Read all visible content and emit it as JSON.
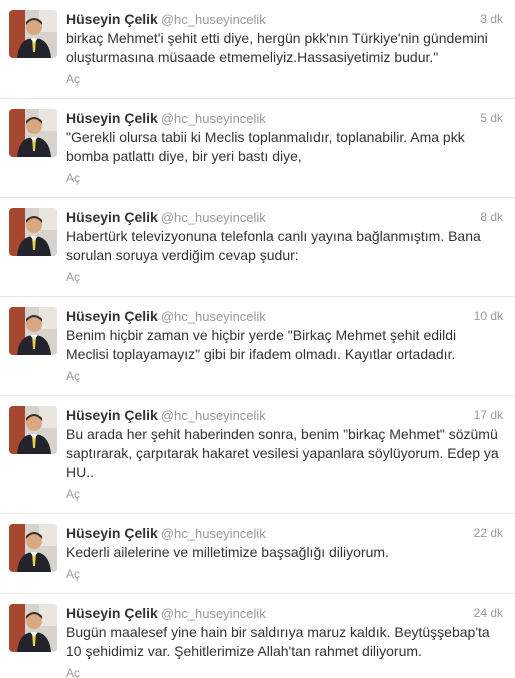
{
  "tweets": [
    {
      "fullname": "Hüseyin Çelik",
      "username": "@hc_huseyincelik",
      "time": "3 dk",
      "text": "birkaç Mehmet'i şehit etti diye, hergün pkk'nın Türkiye'nin gündemini oluşturmasına müsaade etmemeliyiz.Hassasiyetimiz budur.\"",
      "action": "Aç"
    },
    {
      "fullname": "Hüseyin Çelik",
      "username": "@hc_huseyincelik",
      "time": "5 dk",
      "text": "\"Gerekli olursa tabii ki Meclis toplanmalıdır, toplanabilir. Ama pkk bomba patlattı diye, bir yeri bastı diye,",
      "action": "Aç"
    },
    {
      "fullname": "Hüseyin Çelik",
      "username": "@hc_huseyincelik",
      "time": "8 dk",
      "text": "Habertürk televizyonuna telefonla canlı yayına bağlanmıştım. Bana sorulan soruya verdiğim cevap şudur:",
      "action": "Aç"
    },
    {
      "fullname": "Hüseyin Çelik",
      "username": "@hc_huseyincelik",
      "time": "10 dk",
      "text": "Benim hiçbir zaman ve hiçbir yerde \"Birkaç Mehmet şehit edildi Meclisi toplayamayız\" gibi bir ifadem olmadı. Kayıtlar ortadadır.",
      "action": "Aç"
    },
    {
      "fullname": "Hüseyin Çelik",
      "username": "@hc_huseyincelik",
      "time": "17 dk",
      "text": "Bu arada her şehit haberinden sonra, benim \"birkaç Mehmet\" sözümü saptırarak, çarpıtarak hakaret vesilesi yapanlara söylüyorum. Edep ya HU..",
      "action": "Aç"
    },
    {
      "fullname": "Hüseyin Çelik",
      "username": "@hc_huseyincelik",
      "time": "22 dk",
      "text": "Kederli ailelerine ve milletimize başsağlığı diliyorum.",
      "action": "Aç"
    },
    {
      "fullname": "Hüseyin Çelik",
      "username": "@hc_huseyincelik",
      "time": "24 dk",
      "text": "Bugün maalesef yine hain bir saldırıya maruz kaldık. Beytüşşebap'ta 10 şehidimiz var. Şehitlerimize Allah'tan rahmet diliyorum.",
      "action": "Aç"
    }
  ]
}
